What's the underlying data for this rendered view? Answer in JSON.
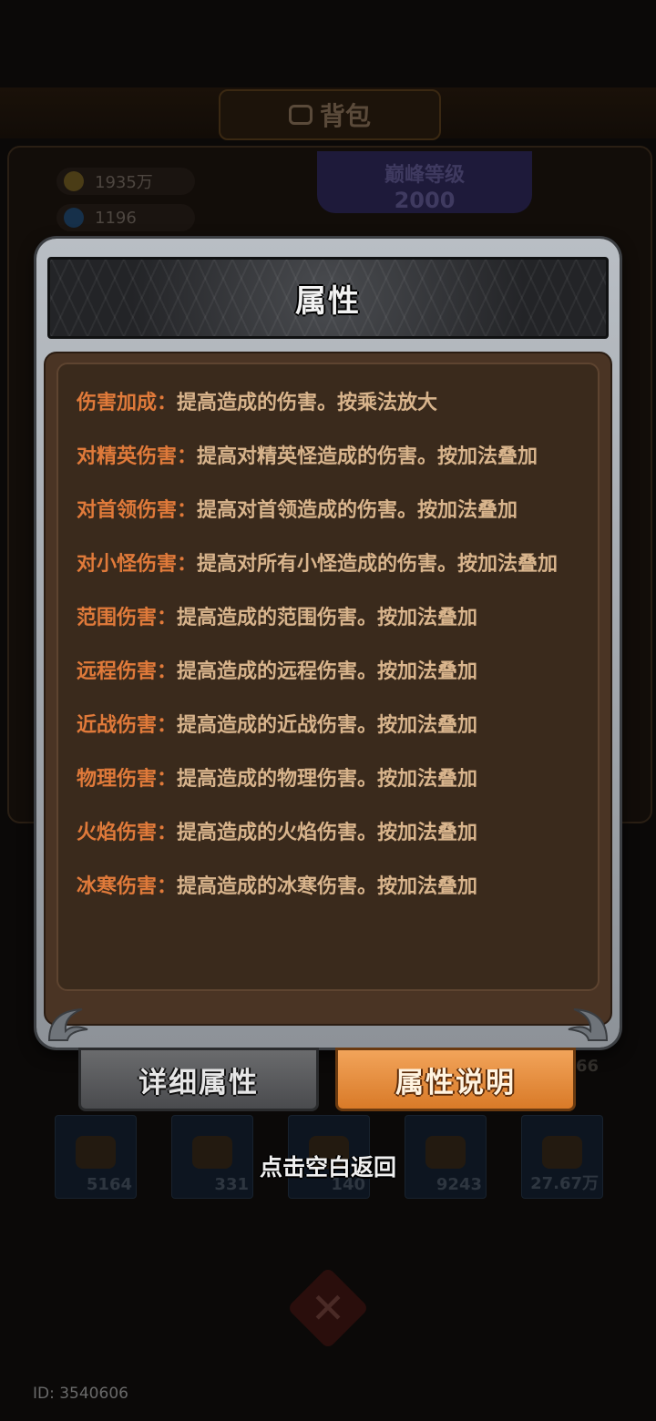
{
  "background": {
    "title": "背包",
    "currency": [
      {
        "value": "1935万",
        "icon": "gold-coin-icon",
        "color": "#c9a227"
      },
      {
        "value": "1196",
        "icon": "blue-gem-icon",
        "color": "#3a8ac9"
      }
    ],
    "peak_level": {
      "label": "巅峰等级",
      "value": "2000"
    },
    "slots": [
      {
        "count": "5164",
        "icon": "scroll-icon"
      },
      {
        "count": "331",
        "icon": "gold-ingot-icon"
      },
      {
        "count": "140",
        "icon": "orb-icon"
      },
      {
        "count": "9243",
        "icon": "parchment-icon"
      },
      {
        "count": "27.67万",
        "icon": "flower-icon"
      }
    ],
    "partial_count": "66"
  },
  "dialog": {
    "title": "属性",
    "attributes": [
      {
        "name": "伤害加成：",
        "desc": "提高造成的伤害。按乘法放大"
      },
      {
        "name": "对精英伤害：",
        "desc": "提高对精英怪造成的伤害。按加法叠加"
      },
      {
        "name": "对首领伤害：",
        "desc": "提高对首领造成的伤害。按加法叠加"
      },
      {
        "name": "对小怪伤害：",
        "desc": "提高对所有小怪造成的伤害。按加法叠加"
      },
      {
        "name": "范围伤害：",
        "desc": "提高造成的范围伤害。按加法叠加"
      },
      {
        "name": "远程伤害：",
        "desc": "提高造成的远程伤害。按加法叠加"
      },
      {
        "name": "近战伤害：",
        "desc": "提高造成的近战伤害。按加法叠加"
      },
      {
        "name": "物理伤害：",
        "desc": "提高造成的物理伤害。按加法叠加"
      },
      {
        "name": "火焰伤害：",
        "desc": "提高造成的火焰伤害。按加法叠加"
      },
      {
        "name": "冰寒伤害：",
        "desc": "提高造成的冰寒伤害。按加法叠加"
      }
    ]
  },
  "tabs": {
    "detail_label": "详细属性",
    "desc_label": "属性说明",
    "active": "属性说明"
  },
  "dismiss_hint": "点击空白返回",
  "user_id": "ID: 3540606",
  "colors": {
    "attr_name": "#e07a3a",
    "attr_desc": "#d8b48c",
    "active_tab": "#e8913e"
  }
}
